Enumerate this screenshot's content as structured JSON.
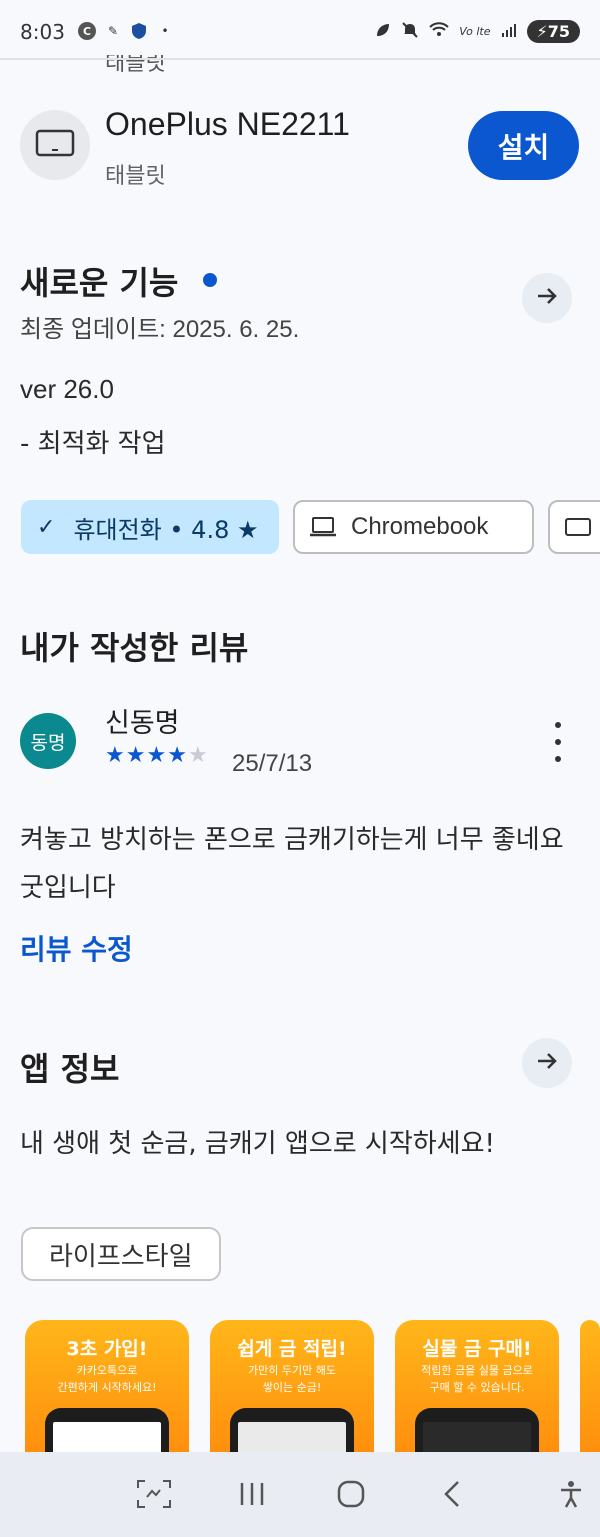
{
  "status_bar": {
    "time": "8:03",
    "battery": "75",
    "network": "Vo lte"
  },
  "cut_off_text": "태블릿",
  "device": {
    "name": "OnePlus NE2211",
    "type": "태블릿",
    "install_label": "설치"
  },
  "whats_new": {
    "title": "새로운 기능",
    "last_updated": "최종 업데이트: 2025. 6. 25.",
    "version": "ver 26.0",
    "notes": "- 최적화 작업"
  },
  "device_chips": [
    {
      "label": "휴대전화 • 4.8 ★",
      "selected": true
    },
    {
      "label": "Chromebook",
      "selected": false
    },
    {
      "label": "",
      "selected": false
    }
  ],
  "my_review": {
    "title": "내가 작성한 리뷰",
    "avatar_text": "동명",
    "reviewer": "신동명",
    "rating": 4,
    "date": "25/7/13",
    "text": "켜놓고 방치하는 폰으로 금캐기하는게 너무 좋네요 굿입니다",
    "edit_label": "리뷰 수정"
  },
  "app_info": {
    "title": "앱 정보",
    "description": "내 생애 첫 순금, 금캐기 앱으로 시작하세요!",
    "category": "라이프스타일"
  },
  "screenshots": [
    {
      "title": "3초 가입!",
      "subtitle_1": "카카오톡으로",
      "subtitle_2": "간편하게 시작하세요!"
    },
    {
      "title": "쉽게 금 적립!",
      "subtitle_1": "가만히 두기만 해도",
      "subtitle_2": "쌓이는 순금!"
    },
    {
      "title": "실물 금 구매!",
      "subtitle_1": "적립한 금을 실물 금으로",
      "subtitle_2": "구매 할 수 있습니다."
    }
  ],
  "colors": {
    "accent": "#0b57d0",
    "selected_chip": "#c2e7ff",
    "avatar": "#0a8a8f"
  }
}
